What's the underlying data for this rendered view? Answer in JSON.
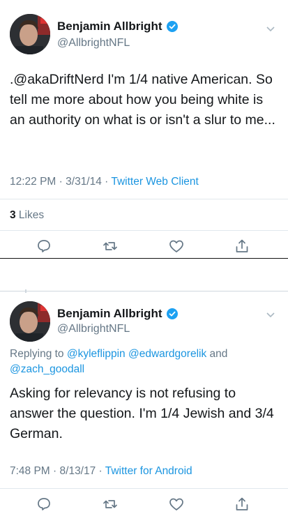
{
  "tweets": [
    {
      "name": "Benjamin Allbright",
      "handle": "@AllbrightNFL",
      "text": ".@akaDriftNerd I'm 1/4 native American. So tell me more about how you being white is an authority on what is or isn't a slur to me...",
      "time": "12:22 PM",
      "date": "3/31/14",
      "sep1": " · ",
      "date_sep": " · ",
      "source": "Twitter Web Client",
      "likes_count": "3",
      "likes_label": " Likes"
    },
    {
      "name": "Benjamin Allbright",
      "handle": "@AllbrightNFL",
      "reply_prefix": "Replying to ",
      "reply_user1": "@kyleflippin",
      "reply_user2": "@edwardgorelik",
      "reply_and": " and",
      "reply_user3": "@zach_goodall",
      "text": "Asking for relevancy is not refusing to answer the question. I'm 1/4 Jewish and 3/4 German.",
      "time": "7:48 PM",
      "date": "8/13/17",
      "sep1": " · ",
      "date_sep": " · ",
      "source": "Twitter for Android"
    }
  ],
  "icons": [
    "verified-badge-icon",
    "chevron-down-icon",
    "reply-icon",
    "retweet-icon",
    "like-icon",
    "share-icon"
  ],
  "colors": {
    "link": "#1b95e0",
    "muted": "#657786",
    "text": "#14171a",
    "verified": "#1da1f2"
  }
}
